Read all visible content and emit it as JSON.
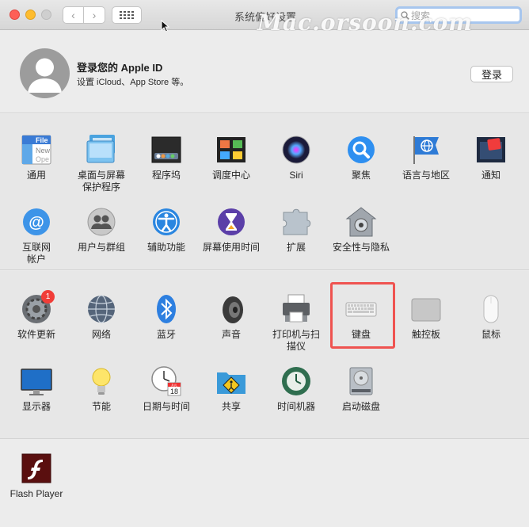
{
  "window": {
    "title": "系统偏好设置",
    "watermark": "Mac.orsoon.com"
  },
  "toolbar": {
    "back": "‹",
    "forward": "›",
    "search_placeholder": "搜索"
  },
  "account": {
    "title": "登录您的 Apple ID",
    "subtitle": "设置 iCloud、App Store 等。",
    "login_label": "登录"
  },
  "row1": [
    {
      "label": "通用",
      "icon": "general-icon"
    },
    {
      "label": "桌面与屏幕保护程序",
      "icon": "desktop-icon"
    },
    {
      "label": "程序坞",
      "icon": "dock-icon"
    },
    {
      "label": "调度中心",
      "icon": "mission-control-icon"
    },
    {
      "label": "Siri",
      "icon": "siri-icon"
    },
    {
      "label": "聚焦",
      "icon": "spotlight-icon"
    },
    {
      "label": "语言与地区",
      "icon": "language-region-icon"
    },
    {
      "label": "通知",
      "icon": "notifications-icon"
    }
  ],
  "row2": [
    {
      "label": "互联网帐户",
      "icon": "internet-accounts-icon"
    },
    {
      "label": "用户与群组",
      "icon": "users-groups-icon"
    },
    {
      "label": "辅助功能",
      "icon": "accessibility-icon"
    },
    {
      "label": "屏幕使用时间",
      "icon": "screen-time-icon"
    },
    {
      "label": "扩展",
      "icon": "extensions-icon"
    },
    {
      "label": "安全性与隐私",
      "icon": "security-icon"
    }
  ],
  "row3": [
    {
      "label": "软件更新",
      "icon": "software-update-icon",
      "badge": "1"
    },
    {
      "label": "网络",
      "icon": "network-icon"
    },
    {
      "label": "蓝牙",
      "icon": "bluetooth-icon"
    },
    {
      "label": "声音",
      "icon": "sound-icon"
    },
    {
      "label": "打印机与扫描仪",
      "icon": "printer-icon"
    },
    {
      "label": "键盘",
      "icon": "keyboard-icon"
    },
    {
      "label": "触控板",
      "icon": "trackpad-icon"
    },
    {
      "label": "鼠标",
      "icon": "mouse-icon"
    }
  ],
  "row4": [
    {
      "label": "显示器",
      "icon": "display-icon"
    },
    {
      "label": "节能",
      "icon": "energy-saver-icon"
    },
    {
      "label": "日期与时间",
      "icon": "date-time-icon"
    },
    {
      "label": "共享",
      "icon": "sharing-icon"
    },
    {
      "label": "时间机器",
      "icon": "time-machine-icon"
    },
    {
      "label": "启动磁盘",
      "icon": "startup-disk-icon"
    }
  ],
  "row5": [
    {
      "label": "Flash Player",
      "icon": "flash-player-icon"
    }
  ],
  "icon_text": {
    "general_file": "File",
    "general_new": "New",
    "general_open": "Ope",
    "calendar_month": "JUL",
    "calendar_day": "18"
  },
  "colors": {
    "highlight": "#ef5350",
    "badge": "#f13d38",
    "search_focus": "#a7c6ee"
  }
}
